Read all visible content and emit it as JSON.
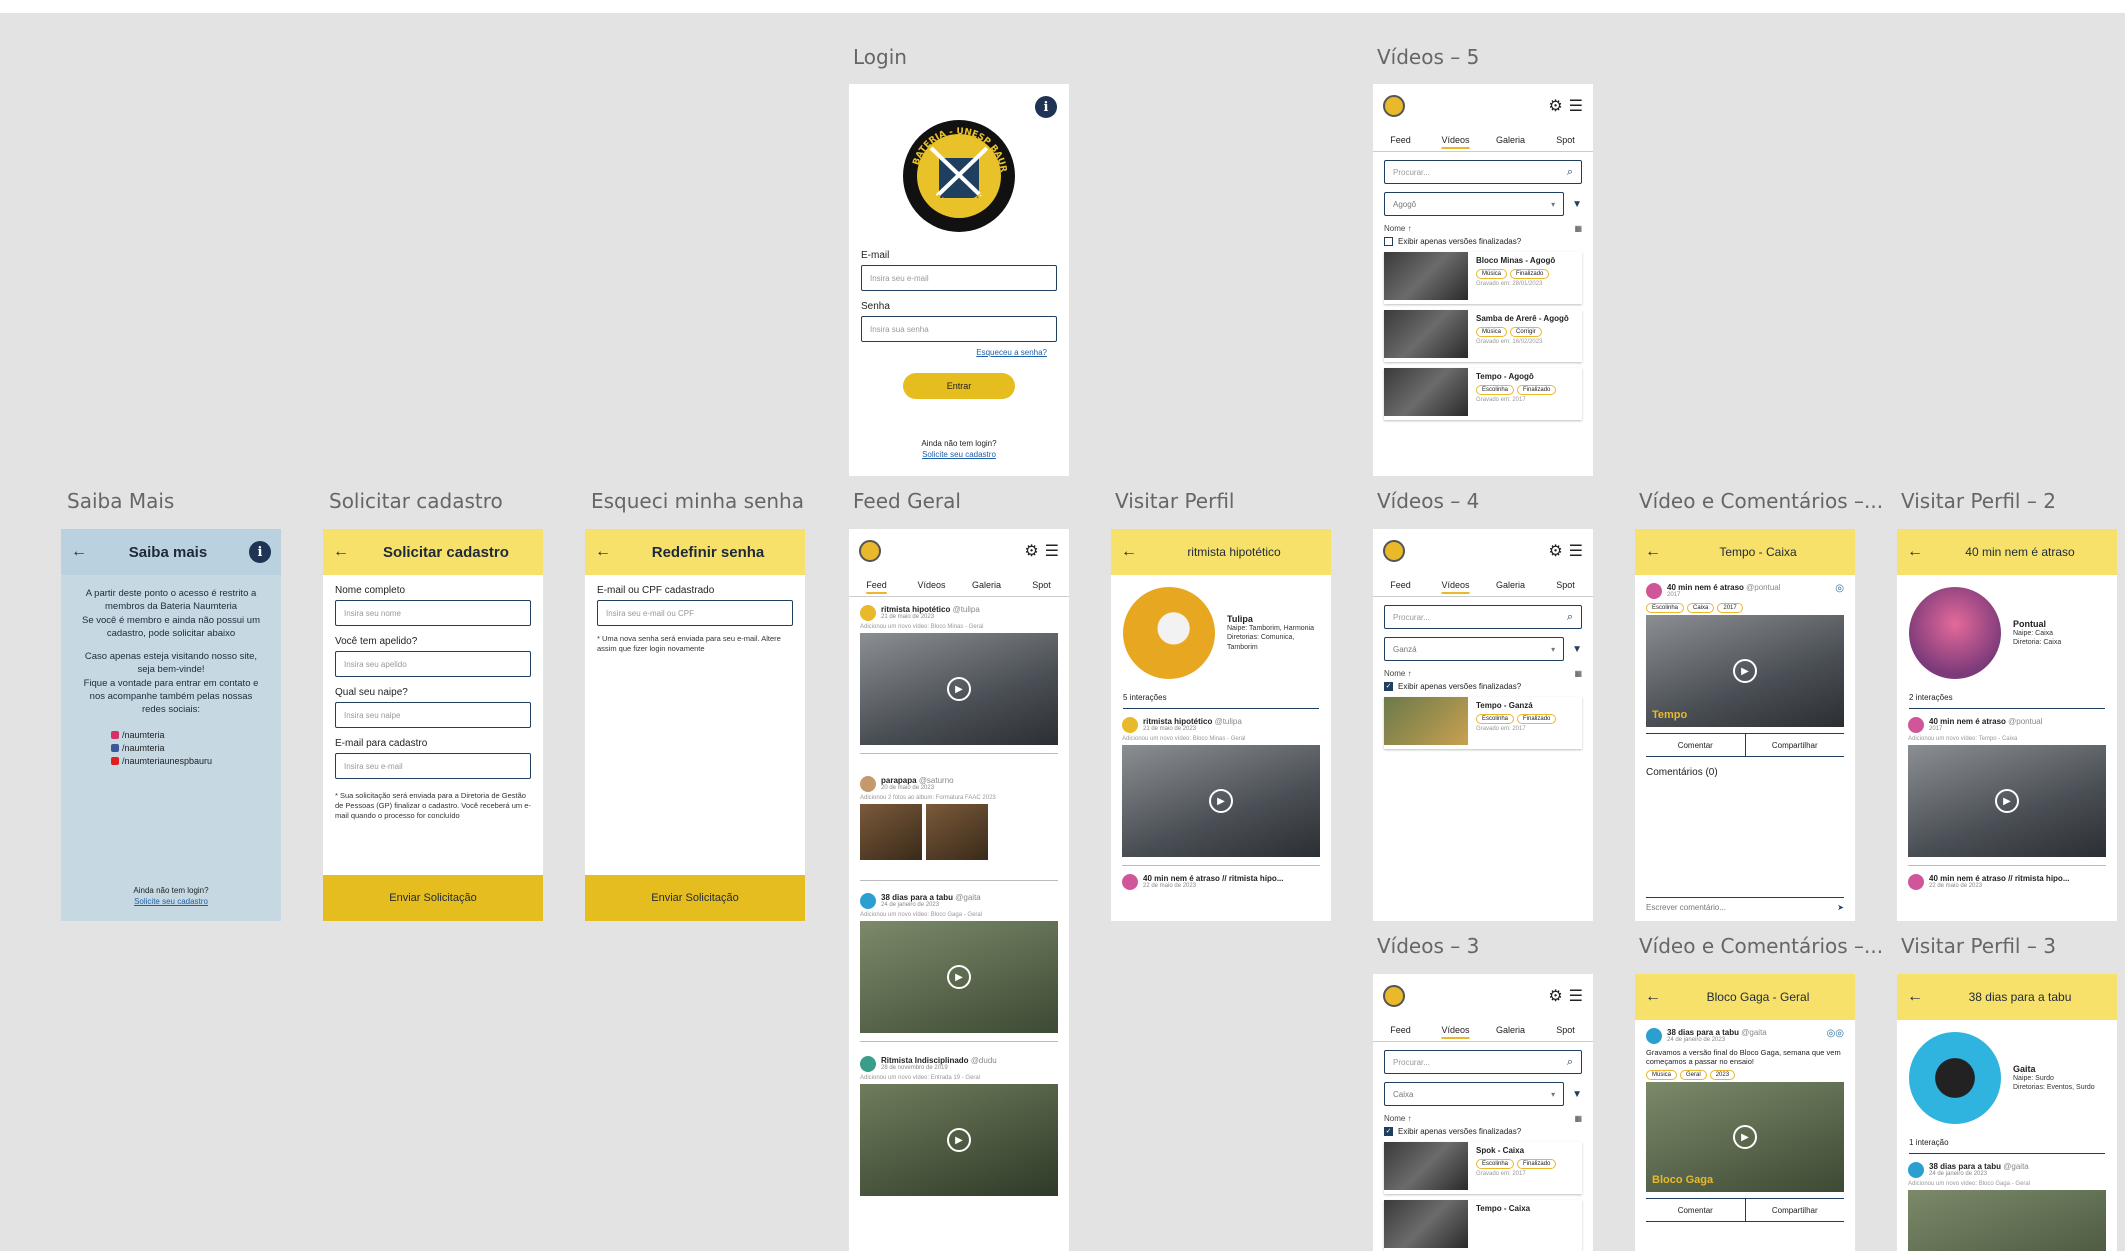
{
  "frames": {
    "login": "Login",
    "videos5": "Vídeos – 5",
    "saiba": "Saiba Mais",
    "solicitar": "Solicitar cadastro",
    "esqueci": "Esqueci minha senha",
    "feed": "Feed Geral",
    "visitar": "Visitar Perfil",
    "videos4": "Vídeos – 4",
    "videocom1": "Vídeo e Comentários –...",
    "visitar2": "Visitar Perfil – 2",
    "videos3": "Vídeos – 3",
    "videocom2": "Vídeo e Comentários –...",
    "visitar3": "Visitar Perfil – 3"
  },
  "login": {
    "logo_text_top": "BATERIA - UNESP BAURU",
    "logo_text_bottom": "NAUMTERIA",
    "email_label": "E-mail",
    "email_placeholder": "Insira seu e-mail",
    "senha_label": "Senha",
    "senha_placeholder": "Insira sua senha",
    "forgot": "Esqueceu a senha?",
    "entrar": "Entrar",
    "no_login": "Ainda não tem login?",
    "request": "Solicite seu cadastro"
  },
  "tabs": {
    "feed": "Feed",
    "videos": "Vídeos",
    "galeria": "Galeria",
    "spot": "Spot"
  },
  "videos": {
    "search_placeholder": "Procurar...",
    "sort": "Nome",
    "only_final": "Exibir apenas versões finalizadas?",
    "recorded": "Gravado em:",
    "v5_select": "Agogô",
    "v5_items": [
      {
        "title": "Bloco Minas - Agogô",
        "tag1": "Música",
        "tag2": "Finalizado",
        "date": "Gravado em: 28/01/2023"
      },
      {
        "title": "Samba de Arerê - Agogô",
        "tag1": "Música",
        "tag2": "Corrigir",
        "date": "Gravado em: 16/02/2023"
      },
      {
        "title": "Tempo - Agogô",
        "tag1": "Escolinha",
        "tag2": "Finalizado",
        "date": "Gravado em: 2017"
      }
    ],
    "v4_select": "Ganzá",
    "v4_items": [
      {
        "title": "Tempo - Ganzá",
        "tag1": "Escolinha",
        "tag2": "Finalizado",
        "date": "Gravado em: 2017"
      }
    ],
    "v3_select": "Caixa",
    "v3_items": [
      {
        "title": "Spok - Caixa",
        "tag1": "Escolinha",
        "tag2": "Finalizado",
        "date": "Gravado em: 2017"
      },
      {
        "title": "Tempo - Caixa"
      }
    ]
  },
  "saiba": {
    "title": "Saiba mais",
    "p1": "A partir deste ponto o acesso é restrito a membros da Bateria Naumteria",
    "p2": "Se você é membro e ainda não possui um cadastro, pode solicitar abaixo",
    "p3": "Caso apenas esteja visitando nosso site, seja bem-vinde!",
    "p4": "Fique a vontade para entrar em contato e nos acompanhe também pelas nossas redes sociais:",
    "ig": "/naumteria",
    "fb": "/naumteria",
    "yt": "/naumteriaunespbauru",
    "no_login": "Ainda não tem login?",
    "request": "Solicite seu cadastro"
  },
  "solicitar": {
    "title": "Solicitar cadastro",
    "f1_label": "Nome completo",
    "f1_ph": "Insira seu nome",
    "f2_label": "Você tem apelido?",
    "f2_ph": "Insira seu apelido",
    "f3_label": "Qual seu naipe?",
    "f3_ph": "Insira seu naipe",
    "f4_label": "E-mail para cadastro",
    "f4_ph": "Insira seu e-mail",
    "note": "* Sua solicitação será enviada para a Diretoria de Gestão de Pessoas (GP) finalizar o cadastro. Você receberá um e-mail quando o processo for concluído",
    "button": "Enviar Solicitação"
  },
  "esqueci": {
    "title": "Redefinir senha",
    "label": "E-mail ou CPF cadastrado",
    "ph": "Insira seu e-mail ou CPF",
    "note": "* Uma nova senha será enviada para seu e-mail. Altere assim que fizer login novamente",
    "button": "Enviar Solicitação"
  },
  "feed": {
    "posts": [
      {
        "name": "ritmista hipotético",
        "handle": "@tulipa",
        "date": "21 de maio de 2023",
        "action": "Adicionou um novo vídeo: Bloco Minas - Geral"
      },
      {
        "name": "parapapa",
        "handle": "@saturno",
        "date": "20 de maio de 2023",
        "action": "Adicionou 2 fotos ao álbum: Formatura FAAC 2023"
      },
      {
        "name": "38 dias para a tabu",
        "handle": "@gaita",
        "date": "24 de janeiro de 2023",
        "action": "Adicionou um novo vídeo: Bloco Gaga - Geral"
      },
      {
        "name": "Ritmista Indisciplinado",
        "handle": "@dudu",
        "date": "28 de novembro de 2019",
        "action": "Adicionou um novo vídeo: Entrada 19 - Geral"
      }
    ]
  },
  "visitar": {
    "title": "ritmista hipotético",
    "name": "Tulipa",
    "naipe": "Naipe: Tamborim, Harmonia",
    "dir": "Diretorias: Comunica, Tamborim",
    "interactions": "5 interações",
    "post_name": "ritmista hipotético",
    "post_handle": "@tulipa",
    "post_date": "21 de maio de 2023",
    "post_action": "Adicionou um novo vídeo: Bloco Minas - Geral",
    "next_name": "40 min nem é atraso // ritmista hipo...",
    "next_date": "22 de maio de 2023"
  },
  "videocom1": {
    "title": "Tempo - Caixa",
    "name": "40 min nem é atraso",
    "handle": "@pontual",
    "date": "2017",
    "tags": [
      "Escolinha",
      "Caixa",
      "2017"
    ],
    "caption": "Tempo",
    "comment": "Comentar",
    "share": "Compartilhar",
    "comments": "Comentários (0)",
    "write": "Escrever comentário..."
  },
  "visitar2": {
    "title": "40 min nem é atraso",
    "name": "Pontual",
    "naipe": "Naipe: Caixa",
    "dir": "Diretoria: Caixa",
    "interactions": "2 interações",
    "post_name": "40 min nem é atraso",
    "post_handle": "@pontual",
    "post_date": "2017",
    "post_action": "Adicionou um novo vídeo: Tempo - Caixa",
    "next_name": "40 min nem é atraso // ritmista hipo...",
    "next_date": "22 de maio de 2023"
  },
  "videocom2": {
    "title": "Bloco Gaga - Geral",
    "name": "38 dias para a tabu",
    "handle": "@gaita",
    "date": "24 de janeiro de 2023",
    "text": "Gravamos a versão final do Bloco Gaga, semana que vem começamos a passar no ensaio!",
    "tags": [
      "Música",
      "Geral",
      "2023"
    ],
    "caption": "Bloco Gaga",
    "comment": "Comentar",
    "share": "Compartilhar"
  },
  "visitar3": {
    "title": "38 dias para a tabu",
    "name": "Gaita",
    "naipe": "Naipe: Surdo",
    "dir": "Diretorias: Eventos, Surdo",
    "interactions": "1 interação",
    "post_name": "38 dias para a tabu",
    "post_handle": "@gaita",
    "post_date": "24 de janeiro de 2023",
    "post_action": "Adicionou um novo vídeo: Bloco Gaga - Geral"
  }
}
